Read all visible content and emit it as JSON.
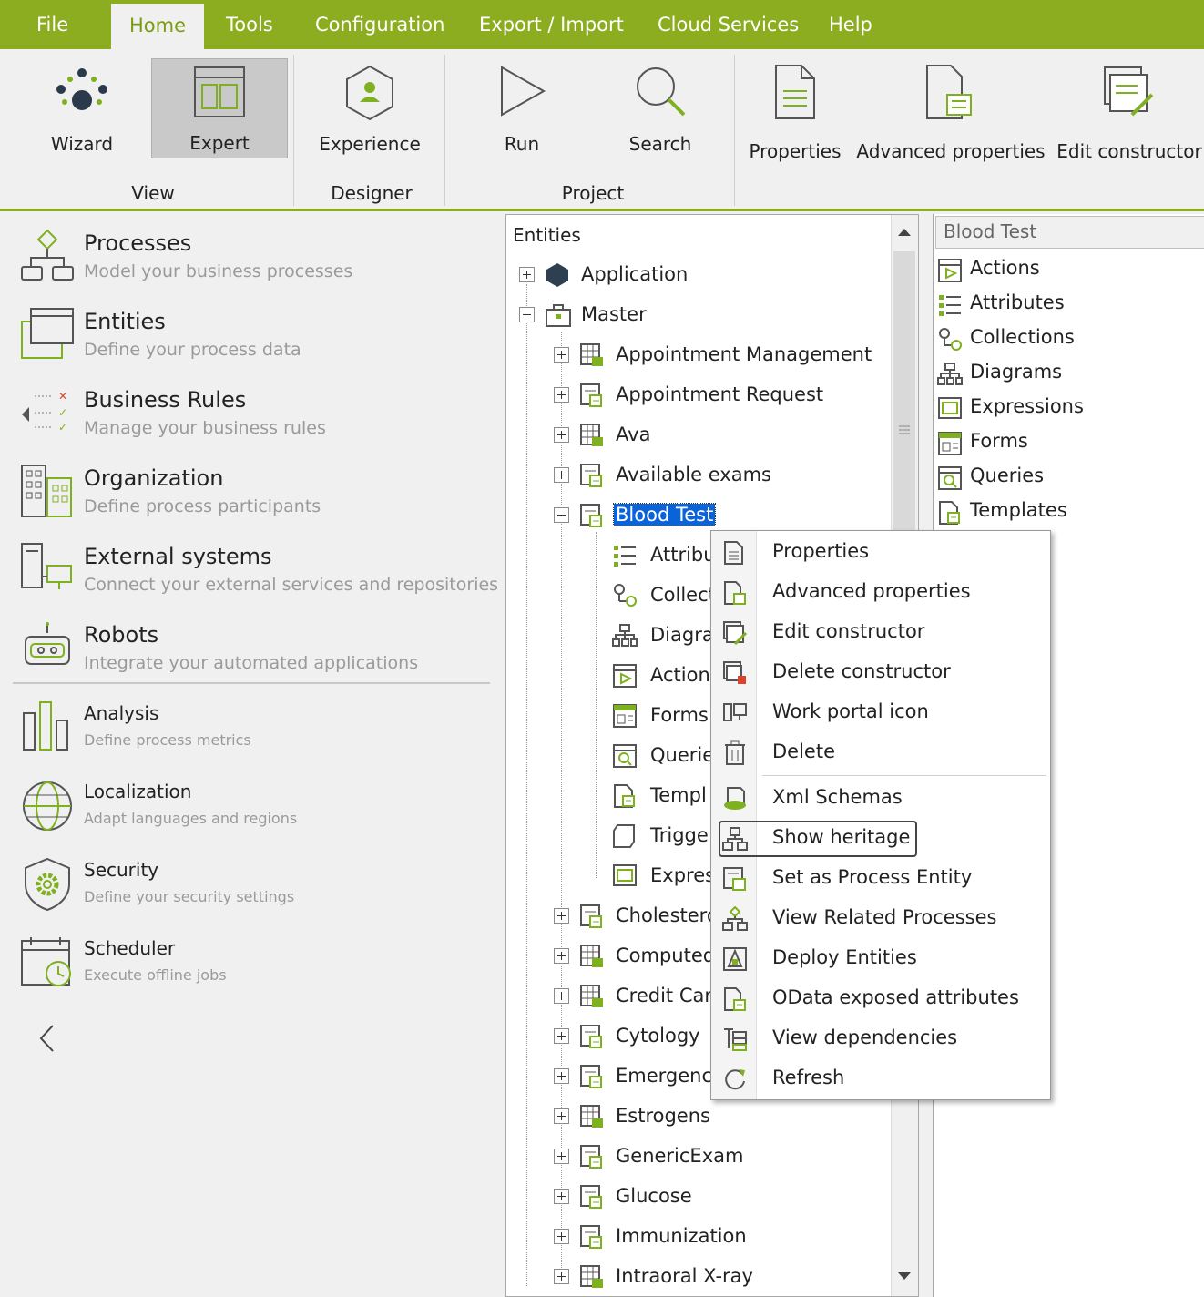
{
  "menu": {
    "items": [
      "File",
      "Home",
      "Tools",
      "Configuration",
      "Export / Import",
      "Cloud Services",
      "Help"
    ],
    "active": "Home"
  },
  "ribbon": {
    "buttons": {
      "wizard": "Wizard",
      "expert": "Expert",
      "experience": "Experience",
      "run": "Run",
      "search": "Search",
      "properties": "Properties",
      "advanced_properties": "Advanced properties",
      "edit_constructor": "Edit constructor"
    },
    "groups": {
      "view": "View",
      "designer": "Designer",
      "project": "Project"
    }
  },
  "nav": {
    "processes": {
      "title": "Processes",
      "sub": "Model your business processes"
    },
    "entities": {
      "title": "Entities",
      "sub": "Define your process data"
    },
    "business_rules": {
      "title": "Business Rules",
      "sub": "Manage your business rules"
    },
    "organization": {
      "title": "Organization",
      "sub": "Define process participants"
    },
    "external_systems": {
      "title": "External systems",
      "sub": "Connect your external services and repositories"
    },
    "robots": {
      "title": "Robots",
      "sub": "Integrate your automated applications"
    },
    "analysis": {
      "title": "Analysis",
      "sub": "Define  process  metrics"
    },
    "localization": {
      "title": "Localization",
      "sub": "Adapt  languages  and  regions"
    },
    "security": {
      "title": "Security",
      "sub": "Define  your  security  settings"
    },
    "scheduler": {
      "title": "Scheduler",
      "sub": "Execute  offline  jobs"
    }
  },
  "tree": {
    "header": "Entities",
    "application": "Application",
    "master": "Master",
    "children_before": [
      "Appointment Management",
      "Appointment Request",
      "Ava",
      "Available exams"
    ],
    "selected": "Blood Test",
    "selected_children": [
      "Attribu",
      "Collect",
      "Diagra",
      "Action",
      "Forms",
      "Querie",
      "Templ",
      "Trigge",
      "Expres"
    ],
    "children_after": [
      "Cholestero",
      "Computed",
      "Credit Car",
      "Cytology",
      "Emergency",
      "Estrogens",
      "GenericExam",
      "Glucose",
      "Immunization",
      "Intraoral X-ray"
    ]
  },
  "right_panel": {
    "header": "Blood Test",
    "items": [
      "Actions",
      "Attributes",
      "Collections",
      "Diagrams",
      "Expressions",
      "Forms",
      "Queries",
      "Templates"
    ]
  },
  "context_menu": {
    "items": [
      "Properties",
      "Advanced properties",
      "Edit constructor",
      "Delete constructor",
      "Work portal icon",
      "Delete",
      "Xml Schemas",
      "Show heritage",
      "Set as Process Entity",
      "View Related Processes",
      "Deploy Entities",
      "OData exposed attributes",
      "View dependencies",
      "Refresh"
    ],
    "focused": "Show heritage"
  },
  "colors": {
    "accent": "#8cad1f",
    "selection": "#0a64d8",
    "icon_green": "#7fb01f"
  }
}
